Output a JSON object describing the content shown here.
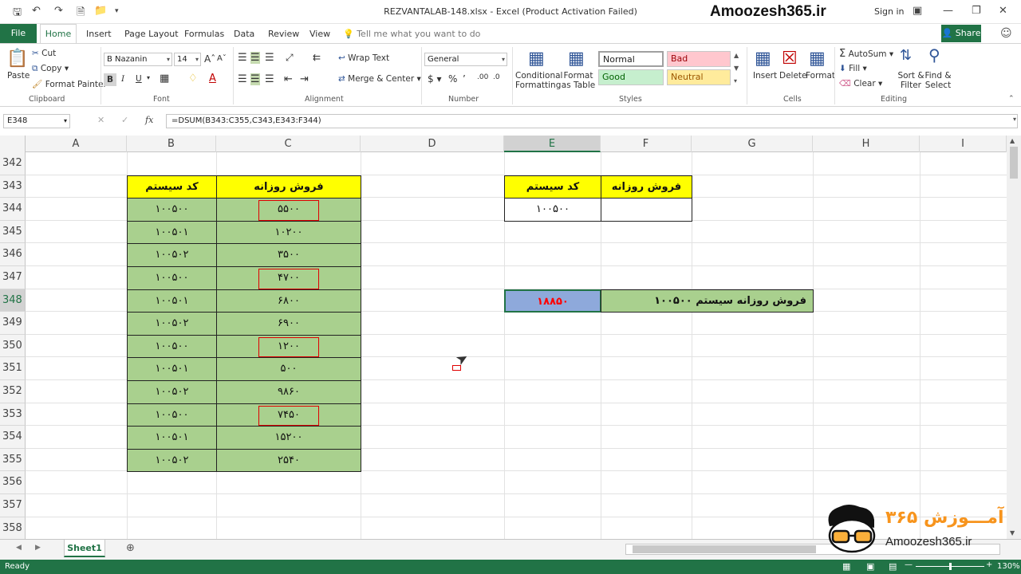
{
  "window": {
    "title": "REZVANTALAB-148.xlsx - Excel (Product Activation Failed)",
    "brand": "Amoozesh365.ir",
    "sign_in": "Sign in"
  },
  "menu": {
    "file": "File",
    "tabs": [
      "Home",
      "Insert",
      "Page Layout",
      "Formulas",
      "Data",
      "Review",
      "View"
    ],
    "tell_me": "Tell me what you want to do",
    "share": "Share"
  },
  "ribbon": {
    "clipboard": {
      "label": "Clipboard",
      "paste": "Paste",
      "cut": "Cut",
      "copy": "Copy",
      "format_painter": "Format Painter"
    },
    "font": {
      "label": "Font",
      "name": "B Nazanin",
      "size": "14",
      "bold": "B",
      "italic": "I",
      "underline": "U"
    },
    "alignment": {
      "label": "Alignment",
      "wrap_text": "Wrap Text",
      "merge_center": "Merge & Center"
    },
    "number": {
      "label": "Number",
      "format": "General"
    },
    "styles": {
      "label": "Styles",
      "conditional": "Conditional Formatting",
      "format_table": "Format as Table",
      "normal": "Normal",
      "bad": "Bad",
      "good": "Good",
      "neutral": "Neutral"
    },
    "cells": {
      "label": "Cells",
      "insert": "Insert",
      "delete": "Delete",
      "format": "Format"
    },
    "editing": {
      "label": "Editing",
      "autosum": "AutoSum",
      "fill": "Fill",
      "clear": "Clear",
      "sort_filter": "Sort & Filter",
      "find_select": "Find & Select"
    }
  },
  "formula_bar": {
    "name_box": "E348",
    "fx": "fx",
    "formula": "=DSUM(B343:C355,C343,E343:F344)"
  },
  "columns": [
    "A",
    "B",
    "C",
    "D",
    "E",
    "F",
    "G",
    "H",
    "I"
  ],
  "rows": [
    "342",
    "343",
    "344",
    "345",
    "346",
    "347",
    "348",
    "349",
    "350",
    "351",
    "352",
    "353",
    "354",
    "355",
    "356",
    "357",
    "358"
  ],
  "table": {
    "header_code": "کد سیستم",
    "header_sales": "فروش روزانه",
    "data": [
      [
        "۱۰۰۵۰۰",
        "۵۵۰۰"
      ],
      [
        "۱۰۰۵۰۱",
        "۱۰۲۰۰"
      ],
      [
        "۱۰۰۵۰۲",
        "۳۵۰۰"
      ],
      [
        "۱۰۰۵۰۰",
        "۴۷۰۰"
      ],
      [
        "۱۰۰۵۰۱",
        "۶۸۰۰"
      ],
      [
        "۱۰۰۵۰۲",
        "۶۹۰۰"
      ],
      [
        "۱۰۰۵۰۰",
        "۱۲۰۰"
      ],
      [
        "۱۰۰۵۰۱",
        "۵۰۰"
      ],
      [
        "۱۰۰۵۰۲",
        "۹۸۶۰"
      ],
      [
        "۱۰۰۵۰۰",
        "۷۴۵۰"
      ],
      [
        "۱۰۰۵۰۱",
        "۱۵۲۰۰"
      ],
      [
        "۱۰۰۵۰۲",
        "۲۵۴۰"
      ]
    ]
  },
  "criteria": {
    "header_code": "کد سیستم",
    "header_sales": "فروش روزانه",
    "code": "۱۰۰۵۰۰",
    "sales": ""
  },
  "result": {
    "value": "۱۸۸۵۰",
    "label": "فروش روزانه سیستم   ۱۰۰۵۰۰"
  },
  "sheet_tabs": {
    "active": "Sheet1"
  },
  "status": {
    "ready": "Ready",
    "zoom": "130%"
  },
  "logo": {
    "text_fa": "آمـــوزش ۳۶۵",
    "text_en": "Amoozesh365.ir"
  },
  "colors": {
    "accent": "#217346",
    "header_yellow": "#ffff00",
    "data_green": "#a9d08e",
    "result_blue": "#8ea9db",
    "result_text": "#ff0000"
  }
}
